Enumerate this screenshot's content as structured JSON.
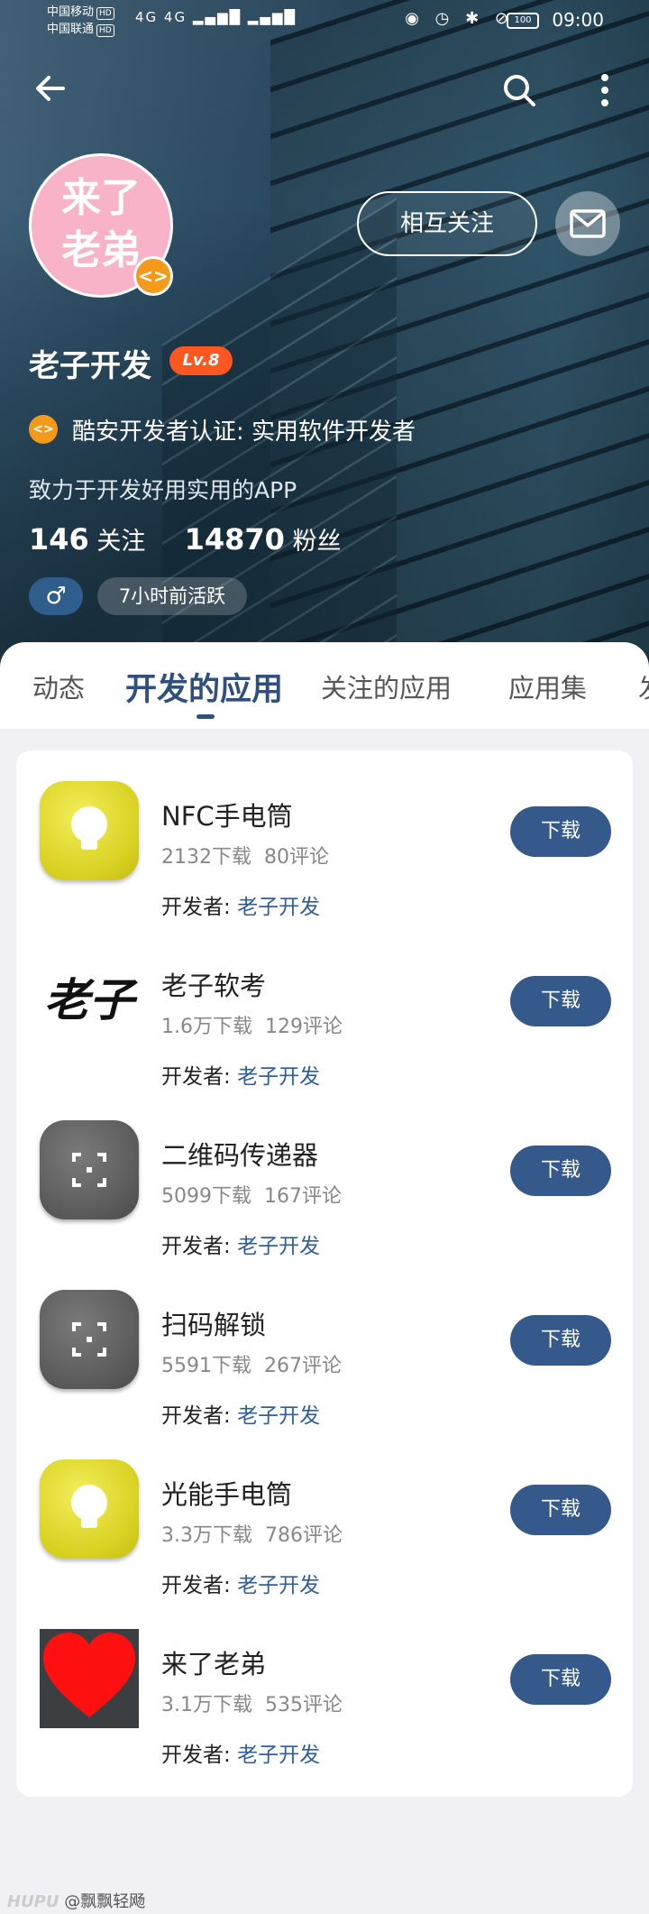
{
  "status_bar": {
    "carrier1": "中国移动",
    "carrier2": "中国联通",
    "hd": "HD",
    "signal": "4G 4G",
    "battery": "100",
    "time": "09:00"
  },
  "profile": {
    "avatar_text_line1": "来了",
    "avatar_text_line2": "老弟",
    "follow_label": "相互关注",
    "username": "老子开发",
    "level": "Lv.8",
    "certification": "酷安开发者认证: 实用软件开发者",
    "bio": "致力于开发好用实用的APP",
    "following_count": "146",
    "following_label": "关注",
    "fans_count": "14870",
    "fans_label": "粉丝",
    "gender_symbol": "♂",
    "last_active": "7小时前活跃"
  },
  "tabs": [
    {
      "label": "动态"
    },
    {
      "label": "开发的应用"
    },
    {
      "label": "关注的应用"
    },
    {
      "label": "应用集"
    },
    {
      "label": "发"
    }
  ],
  "apps": [
    {
      "name": "NFC手电筒",
      "downloads": "2132下载",
      "comments": "80评论",
      "dev_label": "开发者: ",
      "developer": "老子开发",
      "button": "下载",
      "icon": "bulb-icon"
    },
    {
      "name": "老子软考",
      "downloads": "1.6万下载",
      "comments": "129评论",
      "dev_label": "开发者: ",
      "developer": "老子开发",
      "button": "下载",
      "icon": "text-logo-icon",
      "icon_text": "老子"
    },
    {
      "name": "二维码传递器",
      "downloads": "5099下载",
      "comments": "167评论",
      "dev_label": "开发者: ",
      "developer": "老子开发",
      "button": "下载",
      "icon": "scan-frame-icon"
    },
    {
      "name": "扫码解锁",
      "downloads": "5591下载",
      "comments": "267评论",
      "dev_label": "开发者: ",
      "developer": "老子开发",
      "button": "下载",
      "icon": "scan-frame-icon"
    },
    {
      "name": "光能手电筒",
      "downloads": "3.3万下载",
      "comments": "786评论",
      "dev_label": "开发者: ",
      "developer": "老子开发",
      "button": "下载",
      "icon": "bulb-icon"
    },
    {
      "name": "来了老弟",
      "downloads": "3.1万下载",
      "comments": "535评论",
      "dev_label": "开发者: ",
      "developer": "老子开发",
      "button": "下载",
      "icon": "heart-icon"
    }
  ],
  "watermark": {
    "brand": "HUPU",
    "user": "@飘飘轻飏"
  },
  "colors": {
    "accent": "#35598b",
    "level_badge": "#ff5722",
    "verify": "#f39a1a",
    "link": "#2f5e9c"
  }
}
